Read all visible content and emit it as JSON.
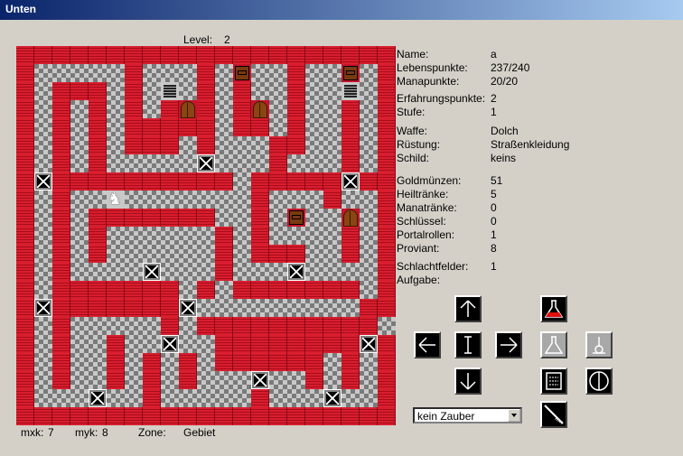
{
  "window": {
    "title": "Unten"
  },
  "level": {
    "label": "Level:",
    "value": "2"
  },
  "stats": [
    {
      "label": "Name:",
      "value": "a"
    },
    {
      "label": "Lebenspunkte:",
      "value": "237/240"
    },
    {
      "label": "Manapunkte:",
      "value": "20/20"
    },
    {
      "label": "Erfahrungspunkte:",
      "value": "2"
    },
    {
      "label": "Stufe:",
      "value": "1"
    },
    {
      "label": "Waffe:",
      "value": "Dolch"
    },
    {
      "label": "Rüstung:",
      "value": "Straßenkleidung"
    },
    {
      "label": "Schild:",
      "value": "keins"
    },
    {
      "label": "Goldmünzen:",
      "value": "51"
    },
    {
      "label": "Heiltränke:",
      "value": "5"
    },
    {
      "label": "Manatränke:",
      "value": "0"
    },
    {
      "label": "Schlüssel:",
      "value": "0"
    },
    {
      "label": "Portalrollen:",
      "value": "1"
    },
    {
      "label": "Proviant:",
      "value": "8"
    },
    {
      "label": "Schlachtfelder:",
      "value": "1"
    },
    {
      "label": "Aufgabe:",
      "value": ""
    }
  ],
  "status": {
    "mxk_label": "mxk:",
    "mxk_value": "7",
    "myk_label": "myk:",
    "myk_value": "8",
    "zone_label": "Zone:",
    "zone_value": "Gebiet"
  },
  "spell_select": {
    "value": "kein Zauber"
  },
  "icons": {
    "up": "arrow-up-icon",
    "down": "arrow-down-icon",
    "left": "arrow-left-icon",
    "right": "arrow-right-icon",
    "wait": "wait-icon",
    "heal_potion": "heal-potion-icon",
    "mana_potion": "mana-potion-icon",
    "key": "key-icon",
    "scroll": "scroll-icon",
    "shield": "shield-icon",
    "cast": "cast-spell-icon"
  },
  "map": {
    "cols": 21,
    "rows": 21,
    "legend": {
      "#": "wall",
      ".": "floor",
      "X": "battlefield",
      "D": "door",
      "S": "stairs",
      "C": "chest",
      "H": "hero"
    },
    "grid": [
      "#####################",
      "#.....#...#.C..#..C.#",
      "#.###.#.S.#.#..#..S.#",
      "#.#.#.#.#D#.#D.#..#.#",
      "#.#.#.#####.##.#..#.#",
      "#.#.#.###.#...##..#.#",
      "#.#.#.....X...#...#.#",
      "#X##########.#####X##",
      "#.#..H.......#...#..#",
      "#.#.#######..#.C..D.#",
      "#.#.#......#.#....#.#",
      "#.#.#......#.###..#.#",
      "#.#....X...#...X....#",
      "#.#######.#.#######.#",
      "#X#######X.........##",
      "#.#.....#.##########.#",
      "#.#..#..X..########X#",
      "#.#..#.#.#.######.#.#",
      "#.#..#.#.#...X..#.#.#",
      "#...X..#.....#...X..#",
      "#####################"
    ]
  }
}
